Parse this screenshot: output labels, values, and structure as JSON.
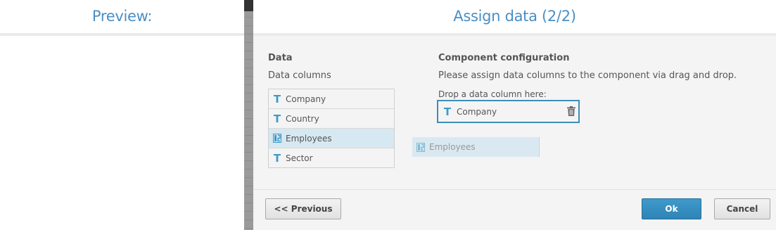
{
  "preview": {
    "title": "Preview:"
  },
  "dialog": {
    "title": "Assign data (2/2)",
    "data_section": {
      "heading": "Data",
      "subheading": "Data columns",
      "columns": [
        {
          "label": "Company",
          "type": "text",
          "icon": "text-type-icon"
        },
        {
          "label": "Country",
          "type": "text",
          "icon": "text-type-icon"
        },
        {
          "label": "Employees",
          "type": "numeric",
          "icon": "numeric-type-icon",
          "selected": true
        },
        {
          "label": "Sector",
          "type": "text",
          "icon": "text-type-icon"
        }
      ]
    },
    "config_section": {
      "heading": "Component configuration",
      "description": "Please assign data columns to the component via drag and drop.",
      "drop_label": "Drop a data column here:",
      "assigned": {
        "label": "Company",
        "icon": "text-type-icon"
      }
    },
    "drag_ghost": {
      "label": "Employees",
      "icon": "numeric-type-icon"
    },
    "buttons": {
      "previous": "<< Previous",
      "ok": "Ok",
      "cancel": "Cancel"
    }
  },
  "colors": {
    "accent": "#3d8eb9",
    "title": "#4a8fc4",
    "selected_row": "#d6e8f1"
  }
}
